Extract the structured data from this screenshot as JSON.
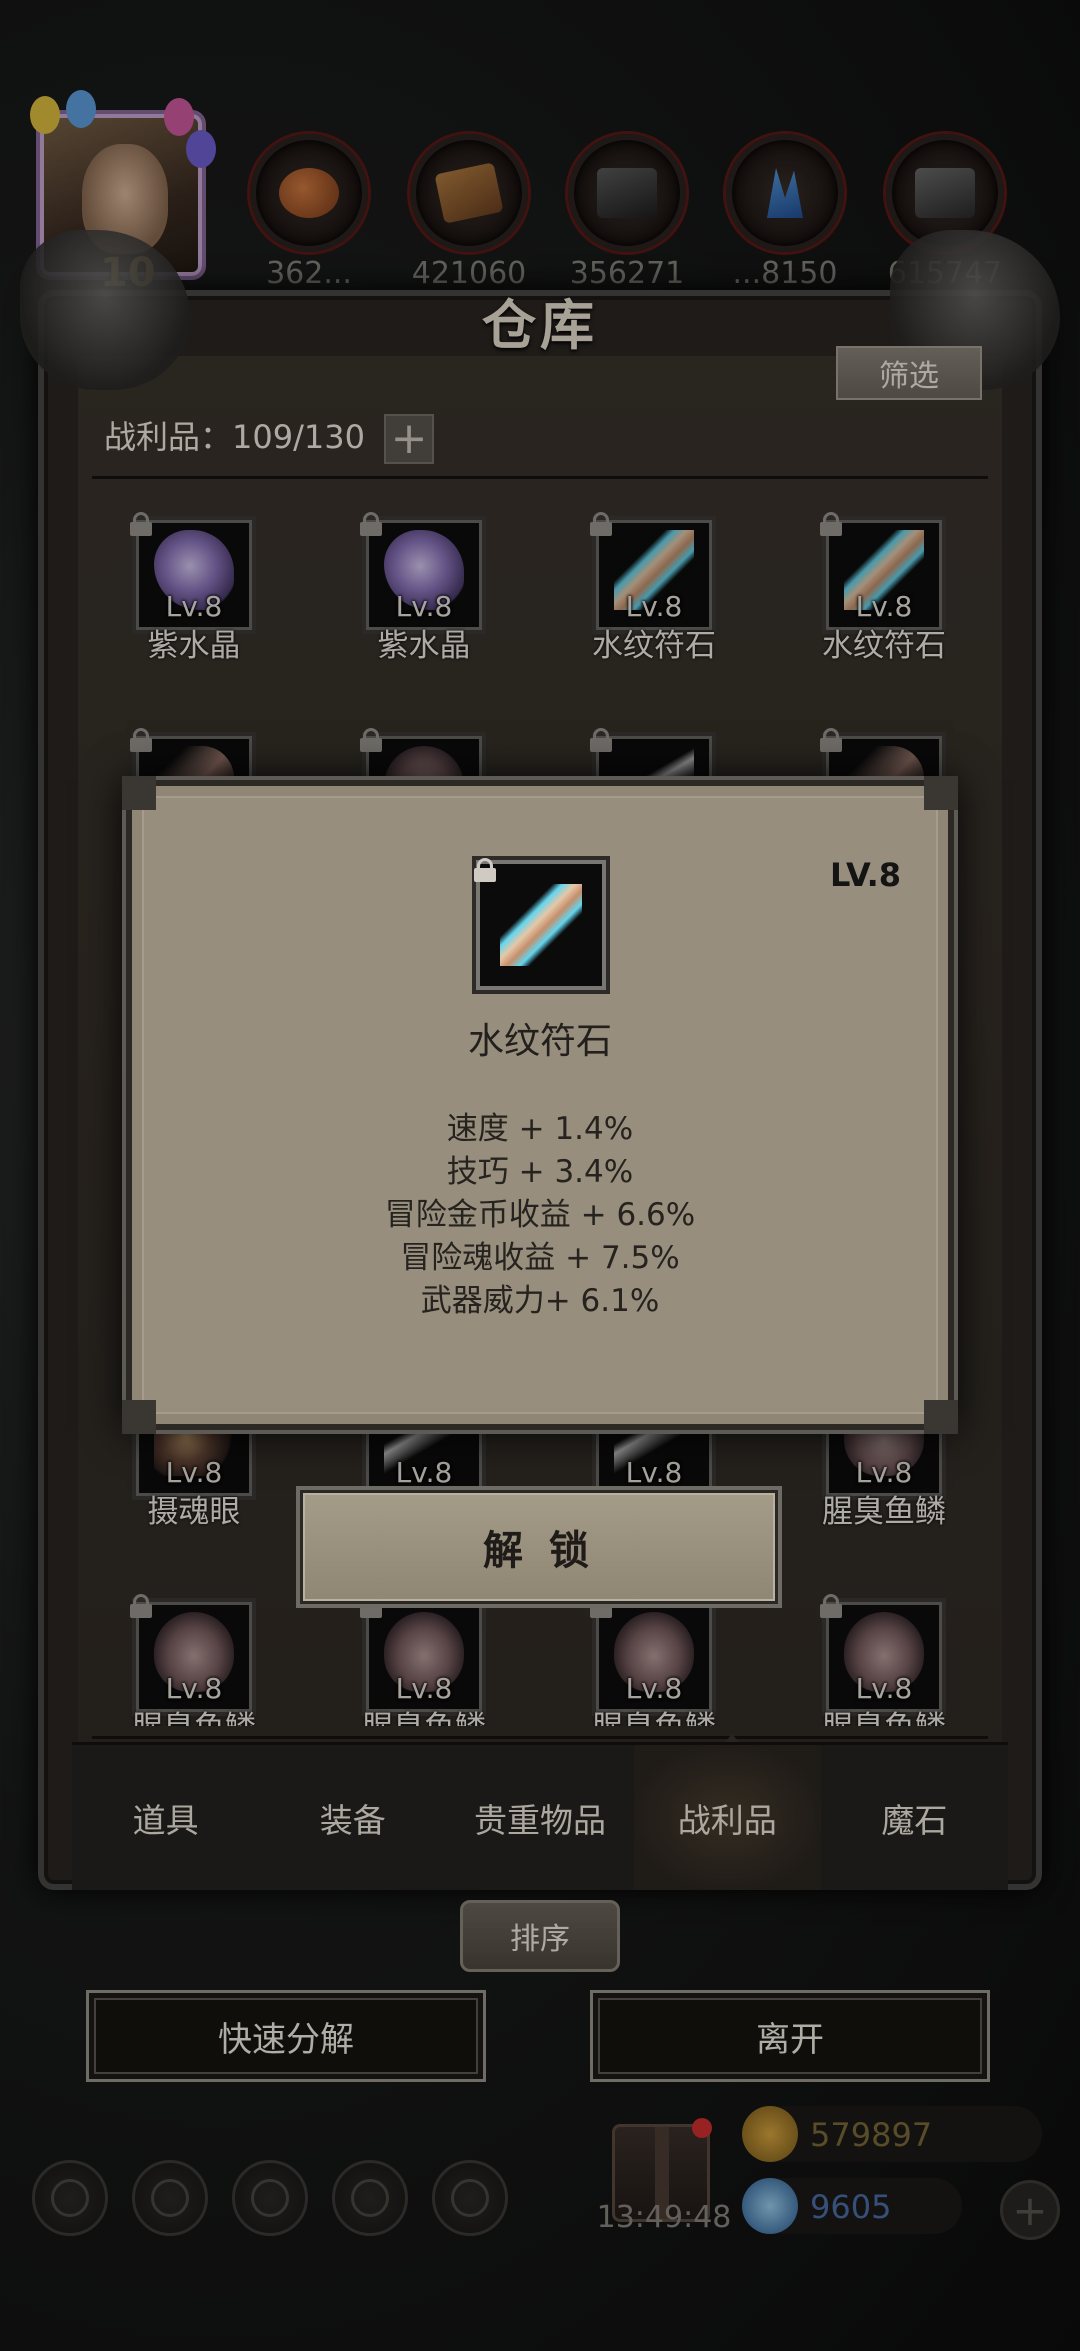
{
  "header": {
    "level": "10",
    "resources": [
      {
        "name": "meat",
        "icon": "meat-icon",
        "count": "362..."
      },
      {
        "name": "wood",
        "icon": "wood-plank-icon",
        "count": "421060"
      },
      {
        "name": "iron",
        "icon": "iron-ingot-icon",
        "count": "356271"
      },
      {
        "name": "crystal",
        "icon": "blue-crystal-icon",
        "count": "...8150"
      },
      {
        "name": "steel",
        "icon": "steel-ingot-icon",
        "count": "615747"
      }
    ]
  },
  "warehouse": {
    "title": "仓库",
    "filter_label": "筛选",
    "count_label": "战利品：109/130",
    "count_plus": "+",
    "items": [
      {
        "name": "紫水晶",
        "level": "Lv.8",
        "icon": "amethyst-icon"
      },
      {
        "name": "紫水晶",
        "level": "Lv.8",
        "icon": "amethyst-icon"
      },
      {
        "name": "水纹符石",
        "level": "Lv.8",
        "icon": "runestone-icon"
      },
      {
        "name": "水纹符石",
        "level": "Lv.8",
        "icon": "runestone-icon"
      },
      {
        "name": "",
        "level": "",
        "icon": "dark-shard-icon"
      },
      {
        "name": "",
        "level": "",
        "icon": "fish-scale-icon"
      },
      {
        "name": "",
        "level": "",
        "icon": "blade-icon"
      },
      {
        "name": "",
        "level": "",
        "icon": "dark-shard-icon"
      },
      {
        "name": "摄魂眼",
        "level": "Lv.8",
        "icon": "eye-orb-icon"
      },
      {
        "name": "",
        "level": "Lv.8",
        "icon": "blade-icon"
      },
      {
        "name": "",
        "level": "Lv.8",
        "icon": "blade-icon"
      },
      {
        "name": "腥臭鱼鳞",
        "level": "Lv.8",
        "icon": "fish-scale-icon"
      },
      {
        "name": "腥臭鱼鳞",
        "level": "Lv.8",
        "icon": "fish-scale-icon"
      },
      {
        "name": "腥臭鱼鳞",
        "level": "Lv.8",
        "icon": "fish-scale-icon"
      },
      {
        "name": "腥臭鱼鳞",
        "level": "Lv.8",
        "icon": "fish-scale-icon"
      },
      {
        "name": "腥臭鱼鳞",
        "level": "Lv.8",
        "icon": "fish-scale-icon"
      }
    ],
    "tabs": [
      {
        "label": "道具",
        "active": false
      },
      {
        "label": "装备",
        "active": false
      },
      {
        "label": "贵重物品",
        "active": false
      },
      {
        "label": "战利品",
        "active": true
      },
      {
        "label": "魔石",
        "active": false
      }
    ],
    "sort_label": "排序"
  },
  "actions": {
    "quick_decompose": "快速分解",
    "leave": "离开"
  },
  "footer": {
    "timer": "13:49:48",
    "gold": "579897",
    "gems": "9605",
    "plus": "+"
  },
  "detail_popup": {
    "level": "LV.8",
    "name": "水纹符石",
    "icon": "runestone-icon",
    "stats": [
      "速度 + 1.4%",
      "技巧 + 3.4%",
      "冒险金币收益 + 6.6%",
      "冒险魂收益 + 7.5%",
      "武器威力+ 6.1%"
    ],
    "unlock_label": "解 锁"
  },
  "colors": {
    "panel": "#2b2623",
    "popup": "#978e7e",
    "gold_text": "#7a6a3a",
    "gem_text": "#4b6fa8"
  }
}
